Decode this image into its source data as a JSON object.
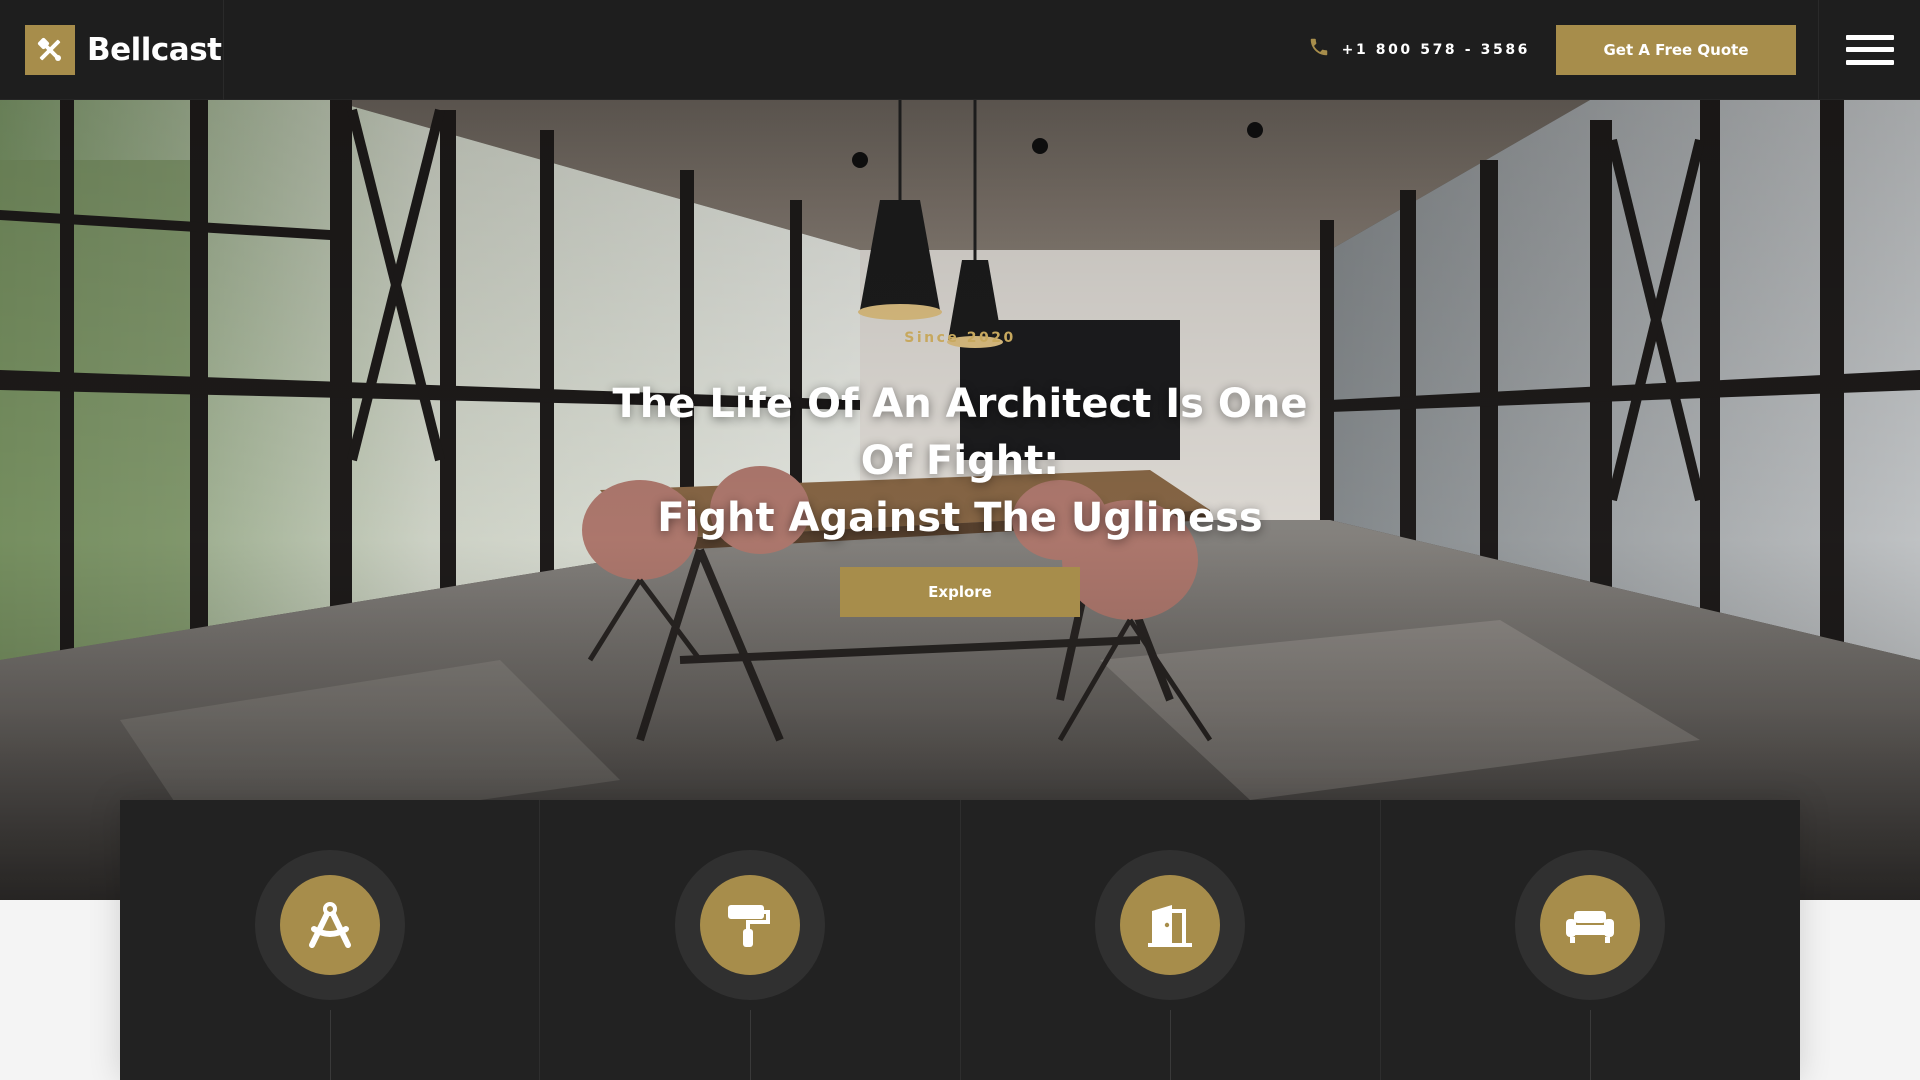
{
  "brand": {
    "name": "Bellcast",
    "icon": "tools-icon"
  },
  "header": {
    "phone": {
      "icon": "phone-icon",
      "number": "+1 800 578 - 3586"
    },
    "quote_button": "Get A Free Quote",
    "menu_icon": "hamburger-menu-icon"
  },
  "hero": {
    "eyebrow": "Since 2020",
    "title_line1": "The Life Of An Architect Is One Of Fight:",
    "title_line2": "Fight Against The Ugliness",
    "button": "Explore"
  },
  "services": [
    {
      "icon": "drafting-compass-icon"
    },
    {
      "icon": "paint-roller-icon"
    },
    {
      "icon": "door-open-icon"
    },
    {
      "icon": "sofa-icon"
    }
  ],
  "colors": {
    "accent": "#a78d4b",
    "dark": "#1e1e1e",
    "panel": "#222222"
  }
}
